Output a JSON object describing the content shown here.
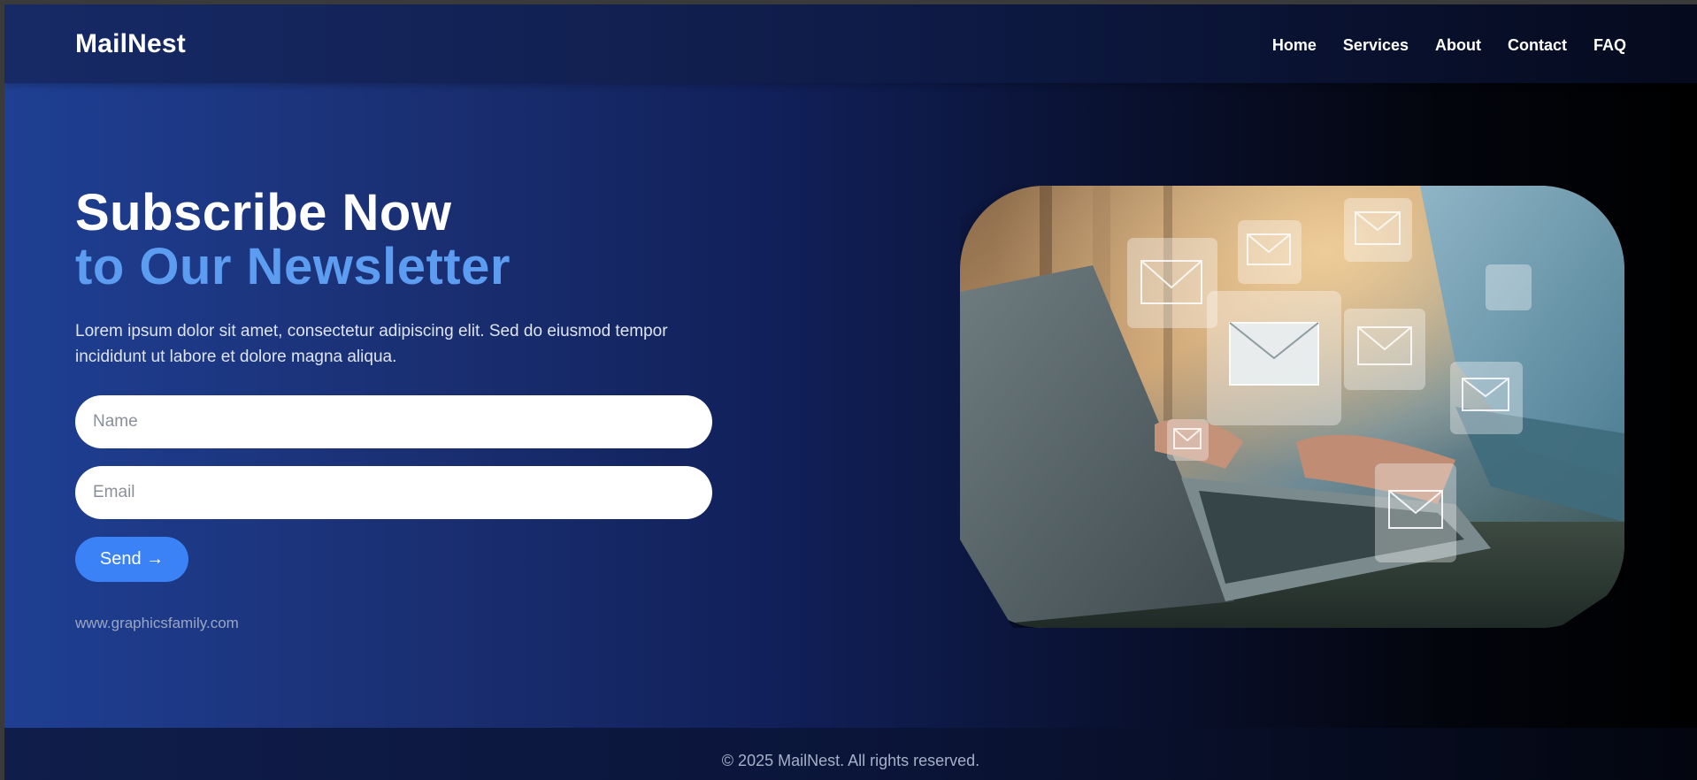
{
  "brand": {
    "name": "MailNest"
  },
  "nav": {
    "items": [
      {
        "label": "Home"
      },
      {
        "label": "Services"
      },
      {
        "label": "About"
      },
      {
        "label": "Contact"
      },
      {
        "label": "FAQ"
      }
    ]
  },
  "hero": {
    "title_line1": "Subscribe Now",
    "title_line2": "to Our Newsletter",
    "description": "Lorem ipsum dolor sit amet, consectetur adipiscing elit. Sed do eiusmod tempor incididunt ut labore et dolore magna aliqua.",
    "name_placeholder": "Name",
    "name_value": "",
    "email_placeholder": "Email",
    "email_value": "",
    "send_label": "Send →",
    "credit": "www.graphicsfamily.com",
    "image_icon": "laptop-with-floating-envelopes-image"
  },
  "footer": {
    "text": "© 2025 MailNest. All rights reserved."
  },
  "colors": {
    "accent": "#3b82f6",
    "title_highlight": "#5c9df2",
    "background_left": "#1f3f93",
    "background_right": "#000000"
  }
}
